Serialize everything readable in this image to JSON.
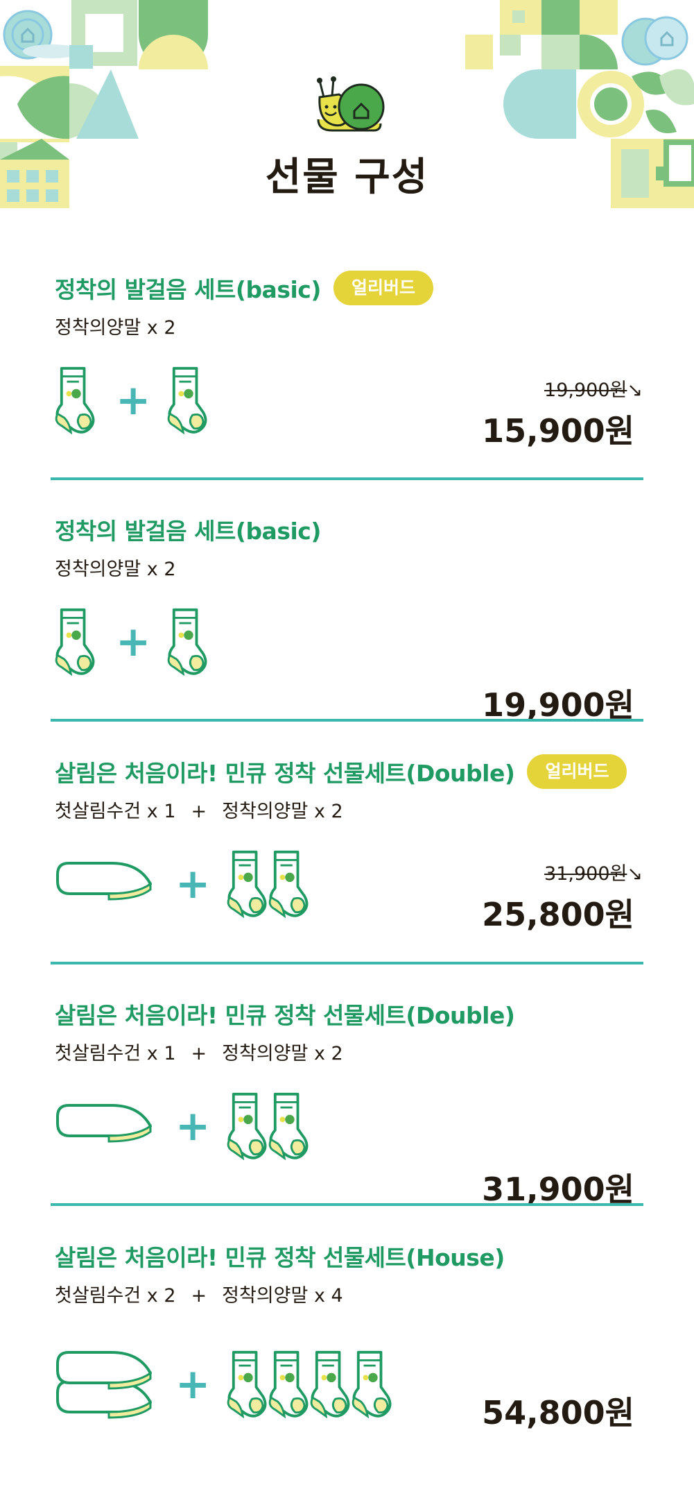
{
  "title": "선물 구성",
  "colors": {
    "accent_green": "#1f9a63",
    "badge_yellow": "#e5d33a",
    "plus_teal": "#47b6b4",
    "divider": "#3ab8ad"
  },
  "gifts": [
    {
      "title": "정착의 발걸음 세트(basic)",
      "badge": "얼리버드",
      "items": [
        "정착의양말 x 2"
      ],
      "original_price": "19,900원",
      "price": "15,900원",
      "towels": 0,
      "socks": 2
    },
    {
      "title": "정착의 발걸음 세트(basic)",
      "items": [
        "정착의양말 x 2"
      ],
      "price": "19,900원",
      "towels": 0,
      "socks": 2
    },
    {
      "title": "살림은 처음이라! 민큐 정착 선물세트(Double)",
      "badge": "얼리버드",
      "items": [
        "첫살림수건 x 1",
        "정착의양말 x 2"
      ],
      "original_price": "31,900원",
      "price": "25,800원",
      "towels": 1,
      "socks": 2
    },
    {
      "title": "살림은 처음이라! 민큐 정착 선물세트(Double)",
      "items": [
        "첫살림수건 x 1",
        "정착의양말 x 2"
      ],
      "price": "31,900원",
      "towels": 1,
      "socks": 2
    },
    {
      "title": "살림은 처음이라! 민큐 정착 선물세트(House)",
      "items": [
        "첫살림수건 x 2",
        "정착의양말 x 4"
      ],
      "price": "54,800원",
      "towels": 2,
      "socks": 4
    }
  ],
  "separator": "+",
  "icons": {
    "header": "snail-icon",
    "sock": "sock-icon",
    "towel": "folded-towel-icon",
    "plus": "plus-icon"
  }
}
